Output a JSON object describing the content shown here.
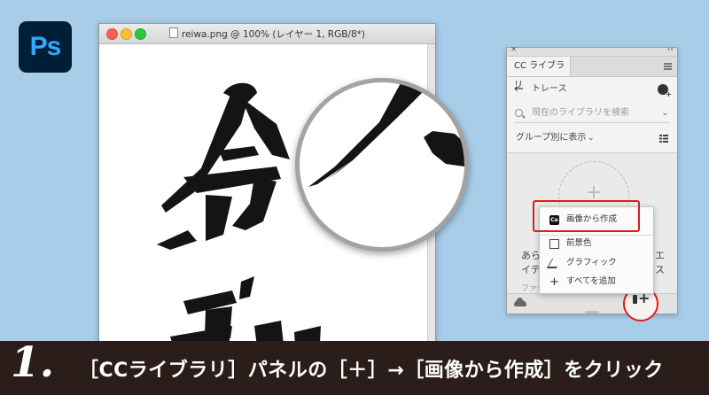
{
  "app": {
    "logo_text": "Ps",
    "logo_bg": "#001e36",
    "logo_fg": "#31a8ff"
  },
  "document": {
    "title": "reiwa.png @ 100% (レイヤー 1, RGB/8*)"
  },
  "panel": {
    "tab_label": "CC ライブラリ",
    "back_label": "トレース",
    "search_placeholder": "現在のライブラリを検索",
    "group_label": "グループ別に表示",
    "body_line1_left": "あら",
    "body_line1_right": "エ",
    "body_line2_left": "イテ",
    "body_line2_right": "ス",
    "body_line3": "ファー"
  },
  "context_menu": {
    "items": [
      {
        "label": "画像から作成",
        "icon": "ca-icon"
      },
      {
        "label": "前景色",
        "icon": "square-icon"
      },
      {
        "label": "グラフィック",
        "icon": "brush-icon"
      },
      {
        "label": "すべてを追加",
        "icon": "plus-icon"
      }
    ]
  },
  "highlight_color": "#e01a1a",
  "caption": {
    "number": "1.",
    "text": "［CCライブラリ］パネルの［＋］→［画像から作成］をクリック"
  }
}
